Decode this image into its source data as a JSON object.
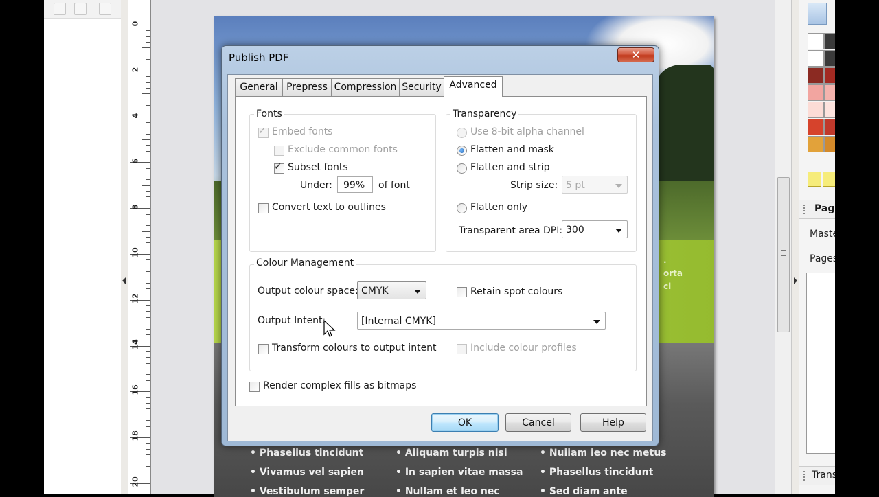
{
  "ruler": {
    "labels": [
      "0",
      "2",
      "4",
      "6",
      "8",
      "10",
      "12",
      "14",
      "16",
      "18",
      "20"
    ]
  },
  "dialog": {
    "title": "Publish PDF",
    "close_label": "✕",
    "tabs": [
      {
        "label": "General",
        "active": false
      },
      {
        "label": "Prepress",
        "active": false
      },
      {
        "label": "Compression",
        "active": false
      },
      {
        "label": "Security",
        "active": false
      },
      {
        "label": "Advanced",
        "active": true
      }
    ],
    "fonts": {
      "label": "Fonts",
      "embed_fonts": {
        "label": "Embed fonts",
        "checked": true,
        "enabled": false
      },
      "exclude_common": {
        "label": "Exclude common fonts",
        "checked": false,
        "enabled": false
      },
      "subset_fonts": {
        "label": "Subset fonts",
        "checked": true,
        "enabled": true
      },
      "under_label": "Under:",
      "under_value": "99%",
      "of_font_label": "of font",
      "convert_outlines": {
        "label": "Convert text to outlines",
        "checked": false
      }
    },
    "transparency": {
      "label": "Transparency",
      "use_alpha": {
        "label": "Use 8-bit alpha channel",
        "selected": false,
        "enabled": false
      },
      "flatten_mask": {
        "label": "Flatten and mask",
        "selected": true
      },
      "flatten_strip": {
        "label": "Flatten and strip",
        "selected": false
      },
      "strip_size_label": "Strip size:",
      "strip_size_value": "5 pt",
      "flatten_only": {
        "label": "Flatten only",
        "selected": false
      },
      "dpi_label": "Transparent area DPI:",
      "dpi_value": "300"
    },
    "colour": {
      "label": "Colour Management",
      "output_space_label": "Output colour space:",
      "output_space_value": "CMYK",
      "retain_spot": {
        "label": "Retain spot colours",
        "checked": false
      },
      "intent_label": "Output Intent:",
      "intent_value": "[Internal CMYK]",
      "transform": {
        "label": "Transform colours to output intent",
        "checked": false
      },
      "include_profiles": {
        "label": "Include colour profiles",
        "checked": false,
        "enabled": false
      }
    },
    "render_bitmaps": {
      "label": "Render complex fills as bitmaps",
      "checked": false
    },
    "buttons": {
      "ok": "OK",
      "cancel": "Cancel",
      "help": "Help"
    }
  },
  "page_content": {
    "green_text": [
      ".",
      "orta",
      "ci"
    ],
    "bullets": [
      [
        "• Phasellus tincidunt",
        "• Aliquam turpis nisi",
        "• Nullam leo nec metus"
      ],
      [
        "• Vivamus vel sapien",
        "• In sapien vitae massa",
        "• Phasellus tincidunt"
      ],
      [
        "• Vestibulum semper",
        "• Nullam et leo nec",
        "• Sed diam ante"
      ]
    ]
  },
  "right_panel": {
    "pages_header": "Pag",
    "master_label": "Maste",
    "pages_label": "Pages",
    "transparency_header": "Trans",
    "swatch_colors": [
      "#ffffff",
      "#3a3a3a",
      "#ffffff",
      "#3a3a3a",
      "#8b2a22",
      "#a32a22",
      "#f2a5a0",
      "#f4b3ad",
      "#fcdcd6",
      "#fde3de",
      "#d6432c",
      "#c0392b",
      "#e2a23a",
      "#d48a2a"
    ]
  },
  "colors": {
    "accent": "#3c7fb1",
    "dialog_frame": "#a9c1dc",
    "page_green": "#b6d64b"
  }
}
